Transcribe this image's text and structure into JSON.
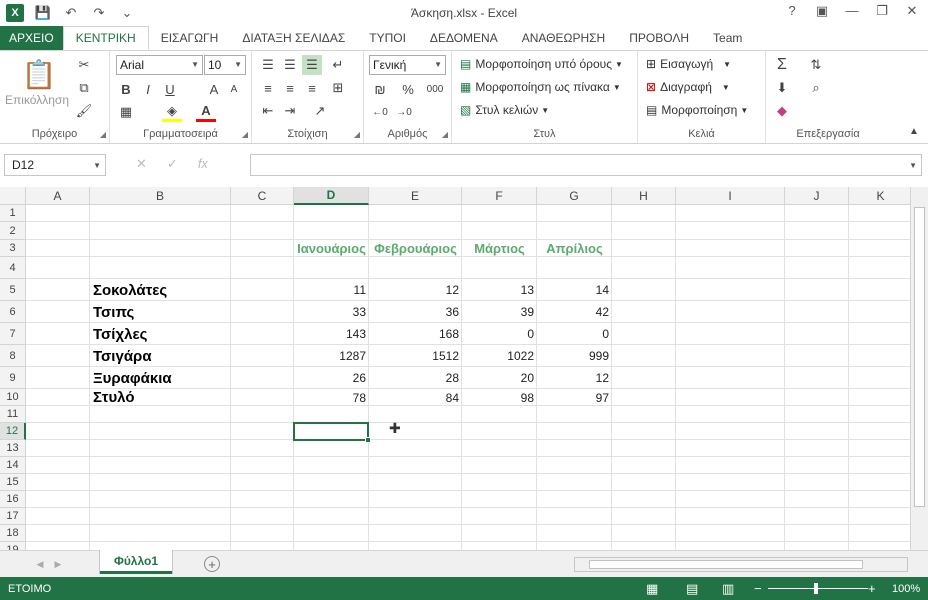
{
  "window": {
    "title": "Άσκηση.xlsx - Excel",
    "app_icon": "X",
    "help": "?",
    "ribbon_display": "▣",
    "minimize": "—",
    "restore": "❐",
    "close": "✕"
  },
  "qat": {
    "save": "💾",
    "undo": "↶",
    "redo": "↷",
    "customize": "⌄"
  },
  "tabs": [
    {
      "label": "ΑΡΧΕΙΟ"
    },
    {
      "label": "ΚΕΝΤΡΙΚΗ"
    },
    {
      "label": "ΕΙΣΑΓΩΓΗ"
    },
    {
      "label": "ΔΙΑΤΑΞΗ ΣΕΛΙΔΑΣ"
    },
    {
      "label": "ΤΥΠΟΙ"
    },
    {
      "label": "ΔΕΔΟΜΕΝΑ"
    },
    {
      "label": "ΑΝΑΘΕΩΡΗΣΗ"
    },
    {
      "label": "ΠΡΟΒΟΛΗ"
    },
    {
      "label": "Team"
    }
  ],
  "ribbon": {
    "clipboard": {
      "label": "Πρόχειρο",
      "paste": "Επικόλληση"
    },
    "font": {
      "label": "Γραμματοσειρά",
      "name": "Arial",
      "size": "10",
      "bold": "B",
      "italic": "I",
      "underline": "U",
      "grow": "A",
      "shrink": "A"
    },
    "alignment": {
      "label": "Στοίχιση"
    },
    "number": {
      "label": "Αριθμός",
      "format": "Γενική",
      "percent": "%",
      "thousands": "000"
    },
    "styles": {
      "label": "Στυλ",
      "conditional": "Μορφοποίηση υπό όρους",
      "as_table": "Μορφοποίηση ως πίνακα",
      "cell_styles": "Στυλ κελιών"
    },
    "cells": {
      "label": "Κελιά",
      "insert": "Εισαγωγή",
      "delete": "Διαγραφή",
      "format": "Μορφοποίηση"
    },
    "editing": {
      "label": "Επεξεργασία",
      "sum": "Σ"
    }
  },
  "formula_bar": {
    "name_box": "D12",
    "fx": "fx",
    "cancel": "✕",
    "enter": "✓",
    "value": ""
  },
  "columns": [
    "A",
    "B",
    "C",
    "D",
    "E",
    "F",
    "G",
    "H",
    "I",
    "J",
    "K"
  ],
  "rows": [
    "1",
    "2",
    "3",
    "4",
    "5",
    "6",
    "7",
    "8",
    "9",
    "10",
    "11",
    "12",
    "13",
    "14",
    "15",
    "16",
    "17",
    "18",
    "19"
  ],
  "sheet": {
    "months": [
      "Ιανουάριος",
      "Φεβρουάριος",
      "Μάρτιος",
      "Απρίλιος"
    ],
    "products": [
      {
        "name": "Σοκολάτες",
        "values": [
          "11",
          "12",
          "13",
          "14"
        ]
      },
      {
        "name": "Τσιπς",
        "values": [
          "33",
          "36",
          "39",
          "42"
        ]
      },
      {
        "name": "Τσίχλες",
        "values": [
          "143",
          "168",
          "0",
          "0"
        ]
      },
      {
        "name": "Τσιγάρα",
        "values": [
          "1287",
          "1512",
          "1022",
          "999"
        ]
      },
      {
        "name": "Ξυραφάκια",
        "values": [
          "26",
          "28",
          "20",
          "12"
        ]
      },
      {
        "name": "Στυλό",
        "values": [
          "78",
          "84",
          "98",
          "97"
        ]
      }
    ]
  },
  "sheet_tabs": {
    "active": "Φύλλο1",
    "add": "+"
  },
  "status": {
    "mode": "ΕΤΟΙΜΟ",
    "zoom": "100%",
    "zoom_minus": "−",
    "zoom_plus": "+"
  },
  "colors": {
    "accent": "#217346",
    "month_header": "#5bab6e"
  }
}
